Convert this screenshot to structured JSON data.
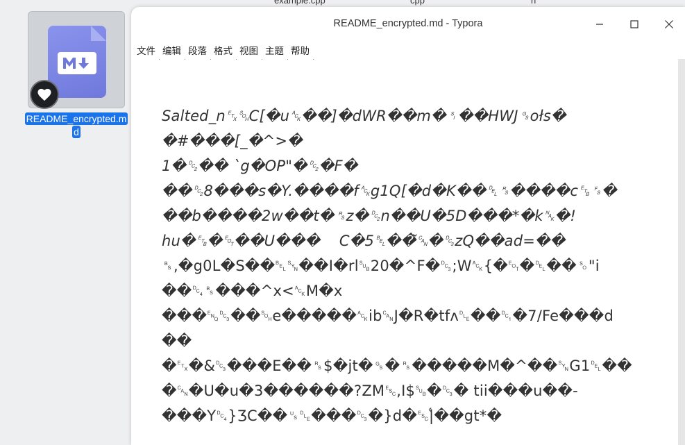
{
  "background_tabs": [
    "example.cpp",
    "cpp",
    "h"
  ],
  "desktop_icon": {
    "label": "README_encrypted.md"
  },
  "window": {
    "title": "README_encrypted.md - Typora",
    "menu": [
      "文件",
      "编辑",
      "段落",
      "格式",
      "视图",
      "主题",
      "帮助"
    ],
    "controls": {
      "minimize": "minimize-icon",
      "maximize": "maximize-icon",
      "close": "close-icon"
    }
  },
  "editor": {
    "lines": [
      "Salted_n␃␁C[�u␆��]�dWR��m�␏��HWJ␝ołs�",
      "�#���[_�^>�",
      "1�␒�� `g�OP\"�␒�F�",
      "��␒8���s�Y.����f␆g1Q[�d�K��␡␞����c␗␜�",
      "��b����2w��t�␞z�␒n��U�5D���*�k␕�!",
      "hu�␗�␄��U���    C�5␇��̃␘�␓zQ��ad=��",
      "␈,�g0L�S��␇␖��I�rl␚20�^F�␓;W␆{�␄�␡��␎\"i",
      "��␔␈���^x<␆M�x",
      "���␅␓��␁e�����␆ib␘J�R�tfʌ␐��␑�7/Fe���d",
      "��",
      "�␃�&␓���E��␞$�jt�␝�␞�����M�^��␖G1␡��",
      "�␘�U�u�3������?ZM␛,I$␚�␓� tii���u��-",
      "���Y␔}ƷC��␟␐���␓�}d�␛|͑��gt*�"
    ],
    "italic_lines": [
      0,
      1,
      2,
      3,
      4,
      5
    ]
  }
}
